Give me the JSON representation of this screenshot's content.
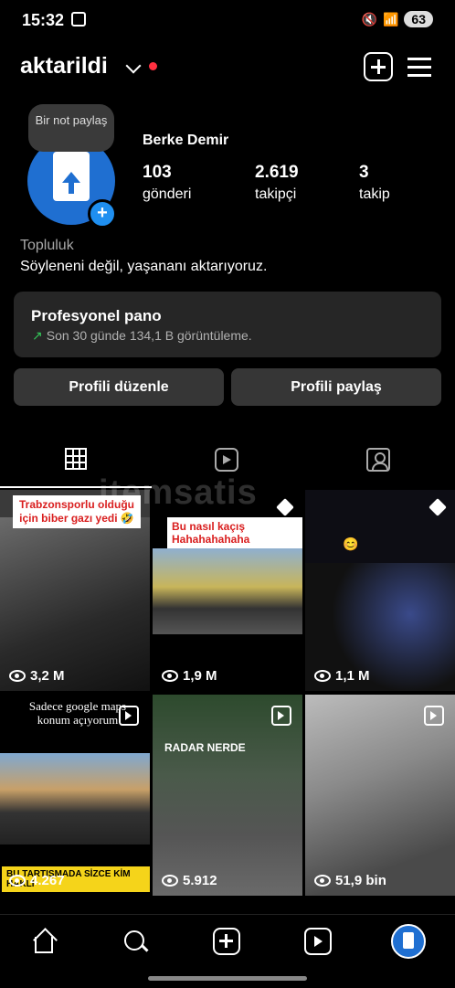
{
  "status": {
    "time": "15:32",
    "battery": "63"
  },
  "header": {
    "username": "aktarildi"
  },
  "profile": {
    "note": "Bir not paylaş",
    "full_name": "Berke Demir",
    "posts": {
      "count": "103",
      "label": "gönderi"
    },
    "followers": {
      "count": "2.619",
      "label": "takipçi"
    },
    "following": {
      "count": "3",
      "label": "takip"
    },
    "category": "Topluluk",
    "bio": "Söyleneni değil, yaşananı aktarıyoruz."
  },
  "dashboard": {
    "title": "Profesyonel pano",
    "subtitle": "Son 30 günde 134,1 B görüntüleme."
  },
  "buttons": {
    "edit": "Profili düzenle",
    "share": "Profili paylaş"
  },
  "watermark": "itemsatis",
  "grid": [
    {
      "caption": "Trabzonsporlu olduğu için biber gazı yedi 🤣",
      "views": "3,2 M",
      "badge": ""
    },
    {
      "caption": "Bu nasıl kaçış Hahahahahaha",
      "views": "1,9 M",
      "badge": "pin"
    },
    {
      "caption": "😊",
      "views": "1,1 M",
      "badge": "pin"
    },
    {
      "caption": "Sadece google maps konum açıyorum",
      "caption2": "BU TARTIŞMADA SİZCE KİM HAKLI",
      "views": "4.267",
      "badge": "reel"
    },
    {
      "caption": "RADAR NERDE",
      "views": "5.912",
      "badge": "reel"
    },
    {
      "caption": "",
      "views": "51,9 bin",
      "badge": "reel"
    }
  ],
  "colors": {
    "accent": "#1f6fd1",
    "notification": "#ff3040",
    "card": "#262626"
  }
}
